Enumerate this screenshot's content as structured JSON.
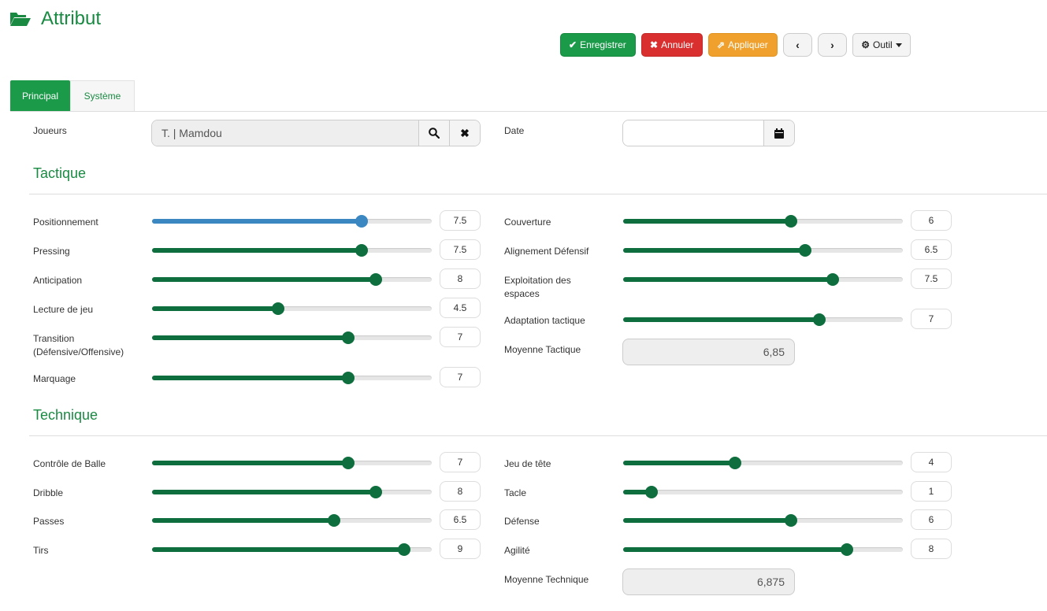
{
  "header": {
    "title": "Attribut",
    "icon": "folder-open-icon"
  },
  "toolbar": {
    "save_label": "Enregistrer",
    "cancel_label": "Annuler",
    "apply_label": "Appliquer",
    "prev_label": "‹",
    "next_label": "›",
    "tool_label": "Outil"
  },
  "colors": {
    "accent": "#1a8a43",
    "slider": "#0e6e3e",
    "slider_active": "#3a87c2",
    "cancel": "#d9302f",
    "apply": "#f0a12d"
  },
  "tabs": [
    {
      "label": "Principal",
      "active": true
    },
    {
      "label": "Système",
      "active": false
    }
  ],
  "form": {
    "joueurs_label": "Joueurs",
    "joueurs_value": "T. | Mamdou",
    "date_label": "Date",
    "date_value": ""
  },
  "tactique": {
    "title": "Tactique",
    "left": [
      {
        "label": "Positionnement",
        "value": "7.5",
        "fraction": 0.75,
        "active": true
      },
      {
        "label": "Pressing",
        "value": "7.5",
        "fraction": 0.75
      },
      {
        "label": "Anticipation",
        "value": "8",
        "fraction": 0.8
      },
      {
        "label": "Lecture de jeu",
        "value": "4.5",
        "fraction": 0.45
      },
      {
        "label": "Transition (Défensive/Offensive)",
        "value": "7",
        "fraction": 0.7
      },
      {
        "label": "Marquage",
        "value": "7",
        "fraction": 0.7
      }
    ],
    "right": [
      {
        "label": "Couverture",
        "value": "6",
        "fraction": 0.6
      },
      {
        "label": "Alignement Défensif",
        "value": "6.5",
        "fraction": 0.65
      },
      {
        "label": "Exploitation des espaces",
        "value": "7.5",
        "fraction": 0.75
      },
      {
        "label": "Adaptation tactique",
        "value": "7",
        "fraction": 0.7
      }
    ],
    "average_label": "Moyenne Tactique",
    "average_value": "6,85"
  },
  "technique": {
    "title": "Technique",
    "left": [
      {
        "label": "Contrôle de Balle",
        "value": "7",
        "fraction": 0.7
      },
      {
        "label": "Dribble",
        "value": "8",
        "fraction": 0.8
      },
      {
        "label": "Passes",
        "value": "6.5",
        "fraction": 0.65
      },
      {
        "label": "Tirs",
        "value": "9",
        "fraction": 0.9
      }
    ],
    "right": [
      {
        "label": "Jeu de tête",
        "value": "4",
        "fraction": 0.4
      },
      {
        "label": "Tacle",
        "value": "1",
        "fraction": 0.1
      },
      {
        "label": "Défense",
        "value": "6",
        "fraction": 0.6
      },
      {
        "label": "Agilité",
        "value": "8",
        "fraction": 0.8
      }
    ],
    "average_label": "Moyenne Technique",
    "average_value": "6,875"
  }
}
